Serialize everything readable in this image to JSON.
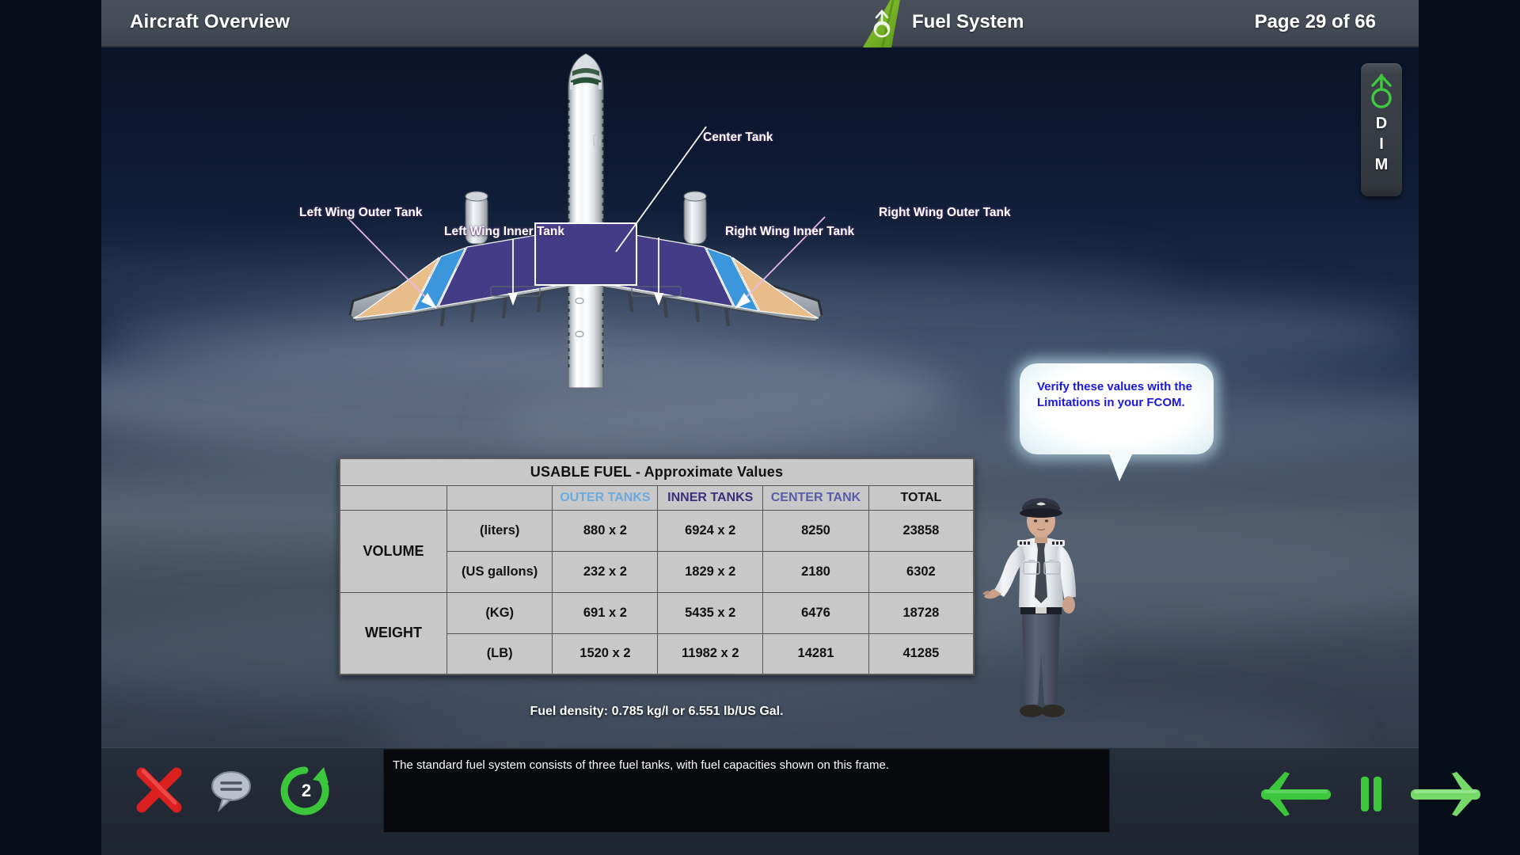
{
  "titlebar": {
    "left_title": "Aircraft Overview",
    "center_title": "Fuel System",
    "page_label": "Page 29 of 66",
    "logo_name": "airline-tailfin-logo"
  },
  "dim_button": {
    "letters": [
      "D",
      "I",
      "M"
    ],
    "icon": "aircraft-power-icon",
    "accent": "#3cc63c"
  },
  "diagram": {
    "title": "aircraft-top-view-fuel-tanks",
    "callouts": [
      {
        "label": "Center Tank",
        "name": "callout-center-tank"
      },
      {
        "label": "Left Wing Outer Tank",
        "name": "callout-left-wing-outer-tank"
      },
      {
        "label": "Left Wing Inner Tank",
        "name": "callout-left-wing-inner-tank"
      },
      {
        "label": "Right Wing Inner Tank",
        "name": "callout-right-wing-inner-tank"
      },
      {
        "label": "Right Wing Outer Tank",
        "name": "callout-right-wing-outer-tank"
      }
    ],
    "tank_colors": {
      "inner_and_center": "#453c87",
      "outer": "#3c96dc",
      "wingtip": "#e8bd8a"
    }
  },
  "chart_data": {
    "type": "table",
    "title": "USABLE FUEL - Approximate Values",
    "columns": [
      "",
      "",
      "OUTER TANKS",
      "INNER TANKS",
      "CENTER TANK",
      "TOTAL"
    ],
    "column_colors": {
      "OUTER TANKS": "#6ea9dd",
      "INNER TANKS": "#3b3079",
      "CENTER TANK": "#5b5ba8",
      "TOTAL": "#111111"
    },
    "row_groups": [
      {
        "group": "VOLUME",
        "rows": [
          {
            "unit": "(liters)",
            "outer": "880 x 2",
            "inner": "6924 x 2",
            "center": "8250",
            "total": "23858"
          },
          {
            "unit": "(US gallons)",
            "outer": "232 x 2",
            "inner": "1829 x 2",
            "center": "2180",
            "total": "6302"
          }
        ]
      },
      {
        "group": "WEIGHT",
        "rows": [
          {
            "unit": "(KG)",
            "outer": "691 x 2",
            "inner": "5435 x 2",
            "center": "6476",
            "total": "18728"
          },
          {
            "unit": "(LB)",
            "outer": "1520 x 2",
            "inner": "11982 x 2",
            "center": "14281",
            "total": "41285"
          }
        ]
      }
    ],
    "footnote": "Fuel density: 0.785 kg/l or 6.551 lb/US Gal."
  },
  "bubble": {
    "text": "Verify these values with the Limitations in your FCOM.",
    "text_color": "#1a18e0"
  },
  "caption": {
    "text": "The standard fuel system consists of three fuel tanks, with fuel capacities shown on this frame."
  },
  "controls": {
    "close": {
      "name": "close-button",
      "icon": "red-x-icon"
    },
    "transcript": {
      "name": "transcript-button",
      "icon": "speech-bubble-icon"
    },
    "replay": {
      "name": "replay-button",
      "icon": "circular-arrow-icon",
      "badge": "2"
    },
    "back": {
      "name": "back-button",
      "icon": "left-arrow-icon"
    },
    "pause": {
      "name": "pause-button",
      "icon": "pause-icon"
    },
    "forward": {
      "name": "forward-button",
      "icon": "right-arrow-icon"
    }
  }
}
